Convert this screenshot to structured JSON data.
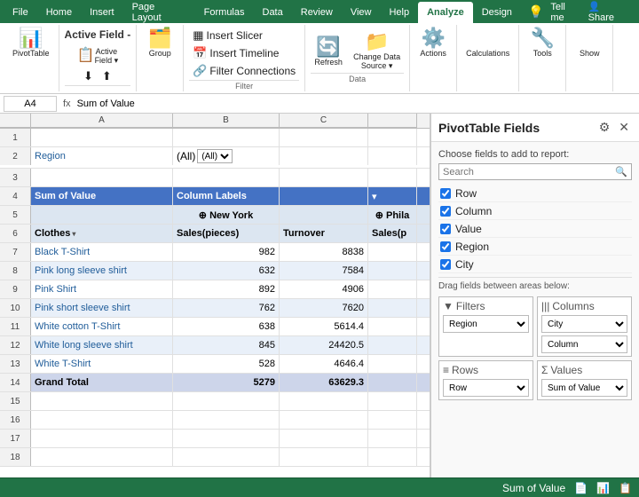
{
  "ribbon": {
    "tabs": [
      "File",
      "Home",
      "Insert",
      "Page Layout",
      "Formulas",
      "Data",
      "Review",
      "View",
      "Help",
      "Analyze",
      "Design"
    ],
    "active_tab": "Analyze",
    "groups": {
      "pivottable": {
        "label": "PivotTable",
        "icon": "📊"
      },
      "active_field": {
        "label": "Active Field -",
        "icon": "📋",
        "buttons": [
          "Active\nField ▾",
          "Drill Down",
          "Drill Up"
        ]
      },
      "group": {
        "label": "Group",
        "icon": "🗂️"
      },
      "filter": {
        "label": "Filter",
        "buttons": [
          "Insert Slicer",
          "Insert Timeline",
          "Filter Connections"
        ]
      },
      "data": {
        "label": "Data",
        "buttons": [
          "Refresh",
          "Change Data\nSource ▾"
        ]
      },
      "actions": {
        "label": "Actions",
        "icon": "⚙️"
      },
      "calculations": {
        "label": "Calculations",
        "icon": "∑"
      },
      "tools": {
        "label": "Tools",
        "icon": "🔧"
      },
      "show": {
        "label": "Show",
        "icon": "👁"
      }
    }
  },
  "formula_bar": {
    "name_box": "A4",
    "formula": "Sum of Value"
  },
  "spreadsheet": {
    "col_headers": [
      "",
      "A",
      "B",
      "C",
      ""
    ],
    "rows": [
      {
        "num": "1",
        "cells": [
          "",
          "",
          "",
          "",
          ""
        ]
      },
      {
        "num": "2",
        "cells": [
          "Region",
          "(All)",
          "",
          "",
          ""
        ]
      },
      {
        "num": "3",
        "cells": [
          "",
          "",
          "",
          "",
          ""
        ]
      },
      {
        "num": "4",
        "cells": [
          "Sum of Value",
          "Column Labels",
          "",
          "",
          "▾"
        ]
      },
      {
        "num": "5",
        "cells": [
          "",
          "⊕ New York",
          "",
          "⊕ Phila",
          ""
        ]
      },
      {
        "num": "6",
        "cells": [
          "Clothes",
          "Sales(pieces)",
          "Turnover",
          "Sales(p",
          ""
        ]
      },
      {
        "num": "7",
        "cells": [
          "Black T-Shirt",
          "982",
          "8838",
          "",
          ""
        ]
      },
      {
        "num": "8",
        "cells": [
          "Pink long sleeve shirt",
          "632",
          "7584",
          "",
          ""
        ]
      },
      {
        "num": "9",
        "cells": [
          "Pink Shirt",
          "892",
          "4906",
          "",
          ""
        ]
      },
      {
        "num": "10",
        "cells": [
          "Pink short sleeve shirt",
          "762",
          "7620",
          "",
          ""
        ]
      },
      {
        "num": "11",
        "cells": [
          "White cotton T-Shirt",
          "638",
          "5614.4",
          "",
          ""
        ]
      },
      {
        "num": "12",
        "cells": [
          "White long sleeve shirt",
          "845",
          "24420.5",
          "",
          ""
        ]
      },
      {
        "num": "13",
        "cells": [
          "White T-Shirt",
          "528",
          "4646.4",
          "",
          ""
        ]
      },
      {
        "num": "14",
        "cells": [
          "Grand Total",
          "",
          "5279",
          "63629.3",
          ""
        ]
      },
      {
        "num": "15",
        "cells": [
          "",
          "",
          "",
          "",
          ""
        ]
      },
      {
        "num": "16",
        "cells": [
          "",
          "",
          "",
          "",
          ""
        ]
      },
      {
        "num": "17",
        "cells": [
          "",
          "",
          "",
          "",
          ""
        ]
      },
      {
        "num": "18",
        "cells": [
          "",
          "",
          "",
          "",
          ""
        ]
      }
    ]
  },
  "pivot_panel": {
    "title": "PivotTable Fields",
    "subtitle": "Choose fields to add to report:",
    "search_placeholder": "Search",
    "fields": [
      {
        "name": "Row",
        "checked": true
      },
      {
        "name": "Column",
        "checked": true
      },
      {
        "name": "Value",
        "checked": true
      },
      {
        "name": "Region",
        "checked": true
      },
      {
        "name": "City",
        "checked": true
      }
    ],
    "drag_hint": "Drag fields between areas below:",
    "areas": {
      "filters": {
        "label": "Filters",
        "value": "Region"
      },
      "columns": {
        "label": "Columns",
        "values": [
          "City",
          "Column"
        ]
      },
      "rows": {
        "label": "Rows",
        "value": "Row"
      },
      "values": {
        "label": "Values",
        "value": "Sum of Value"
      }
    }
  },
  "status_bar": {
    "left": "",
    "sum_label": "Sum of Value",
    "view_icons": [
      "📄",
      "📊",
      "📋"
    ]
  }
}
